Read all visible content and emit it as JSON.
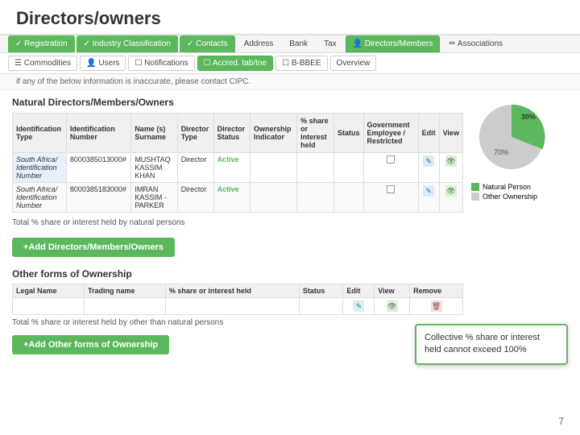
{
  "page": {
    "title": "Directors/owners"
  },
  "nav_primary": [
    {
      "label": "Registration",
      "style": "green",
      "icon": "✓"
    },
    {
      "label": "Industry Classification",
      "style": "green",
      "icon": "✓"
    },
    {
      "label": "Contacts",
      "style": "green",
      "icon": "✓"
    },
    {
      "label": "Address",
      "style": "normal"
    },
    {
      "label": "Bank",
      "style": "normal"
    },
    {
      "label": "Tax",
      "style": "normal"
    },
    {
      "label": "Directors/Members",
      "style": "active",
      "icon": "👤"
    },
    {
      "label": "Associations",
      "style": "normal"
    }
  ],
  "nav_secondary": [
    {
      "label": "Commodities",
      "style": "normal"
    },
    {
      "label": "Users",
      "style": "normal"
    },
    {
      "label": "Notifications",
      "style": "normal"
    },
    {
      "label": "Accred. tab/tne",
      "style": "active"
    },
    {
      "label": "B-BBEE",
      "style": "normal"
    },
    {
      "label": "Overview",
      "style": "normal"
    }
  ],
  "info_message": "if any of the below information is inaccurate, please contact CIPC.",
  "natural_section": {
    "title": "Natural Directors/Members/Owners",
    "table_headers": [
      "Identification Type",
      "Identification Number",
      "Name(s) Surname",
      "Director Type",
      "Director Status",
      "Ownership Indicator",
      "% share or interest held",
      "Status",
      "Government Employee / Restricted",
      "Edit",
      "View"
    ],
    "rows": [
      {
        "id_type": "South Africa/ Identification Number",
        "id_number": "8000385013000#",
        "name": "MUSHTAQ KASSIM KHAN",
        "dir_type": "Director",
        "dir_status": "Active",
        "ownership": "",
        "pct": "",
        "status": "",
        "gov": "",
        "edit": true,
        "view": true
      },
      {
        "id_type": "South Africa/ Identification Number",
        "id_number": "8000385183000#",
        "name": "IMRAN KASSIM - PARKER",
        "dir_type": "Director",
        "dir_status": "Active",
        "ownership": "",
        "pct": "",
        "status": "",
        "gov": "",
        "edit": true,
        "view": true
      }
    ],
    "total_label": "Total % share or interest held by natural persons",
    "add_button": "+Add Directors/Members/Owners"
  },
  "other_forms": {
    "title": "Other forms of Ownership",
    "table_headers": [
      "Legal Name",
      "Trading name",
      "% share or interest held",
      "Status",
      "Edit",
      "View",
      "Remove"
    ],
    "rows": [],
    "total_label": "Total % share or interest held by other than natural persons",
    "add_button": "+Add Other forms of Ownership"
  },
  "tooltip": {
    "text": "Collective % share or interest held cannot exceed 100%"
  },
  "chart": {
    "slices": [
      {
        "label": "Natural Person",
        "color": "#5cb85c",
        "pct": 30
      },
      {
        "label": "Other Ownership",
        "color": "#cccccc",
        "pct": 70
      }
    ],
    "label_30": "30%",
    "label_70": "70%"
  },
  "footer": {
    "page_number": "7"
  }
}
